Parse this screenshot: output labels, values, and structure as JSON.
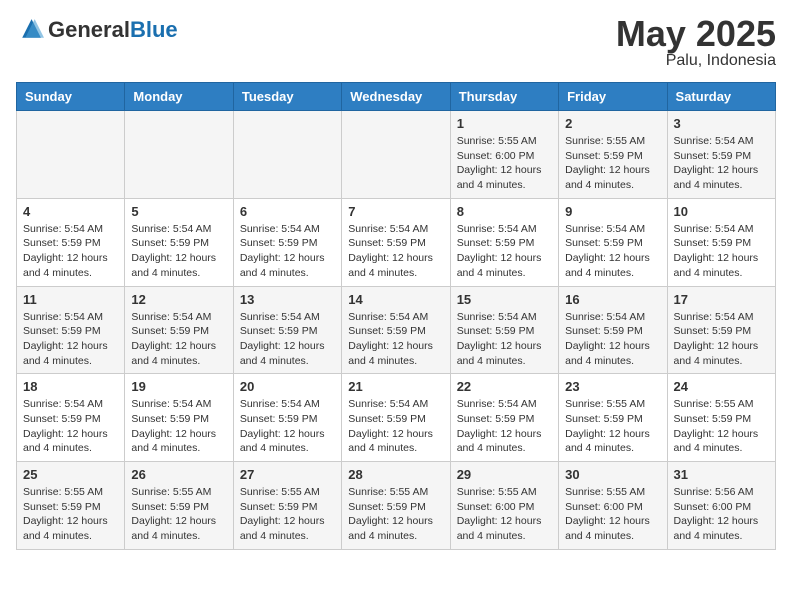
{
  "header": {
    "logo_general": "General",
    "logo_blue": "Blue",
    "month_title": "May 2025",
    "location": "Palu, Indonesia"
  },
  "days_of_week": [
    "Sunday",
    "Monday",
    "Tuesday",
    "Wednesday",
    "Thursday",
    "Friday",
    "Saturday"
  ],
  "weeks": [
    [
      {
        "day": "",
        "info": ""
      },
      {
        "day": "",
        "info": ""
      },
      {
        "day": "",
        "info": ""
      },
      {
        "day": "",
        "info": ""
      },
      {
        "day": "1",
        "sunrise": "5:55 AM",
        "sunset": "6:00 PM",
        "daylight": "12 hours and 4 minutes."
      },
      {
        "day": "2",
        "sunrise": "5:55 AM",
        "sunset": "5:59 PM",
        "daylight": "12 hours and 4 minutes."
      },
      {
        "day": "3",
        "sunrise": "5:54 AM",
        "sunset": "5:59 PM",
        "daylight": "12 hours and 4 minutes."
      }
    ],
    [
      {
        "day": "4",
        "sunrise": "5:54 AM",
        "sunset": "5:59 PM",
        "daylight": "12 hours and 4 minutes."
      },
      {
        "day": "5",
        "sunrise": "5:54 AM",
        "sunset": "5:59 PM",
        "daylight": "12 hours and 4 minutes."
      },
      {
        "day": "6",
        "sunrise": "5:54 AM",
        "sunset": "5:59 PM",
        "daylight": "12 hours and 4 minutes."
      },
      {
        "day": "7",
        "sunrise": "5:54 AM",
        "sunset": "5:59 PM",
        "daylight": "12 hours and 4 minutes."
      },
      {
        "day": "8",
        "sunrise": "5:54 AM",
        "sunset": "5:59 PM",
        "daylight": "12 hours and 4 minutes."
      },
      {
        "day": "9",
        "sunrise": "5:54 AM",
        "sunset": "5:59 PM",
        "daylight": "12 hours and 4 minutes."
      },
      {
        "day": "10",
        "sunrise": "5:54 AM",
        "sunset": "5:59 PM",
        "daylight": "12 hours and 4 minutes."
      }
    ],
    [
      {
        "day": "11",
        "sunrise": "5:54 AM",
        "sunset": "5:59 PM",
        "daylight": "12 hours and 4 minutes."
      },
      {
        "day": "12",
        "sunrise": "5:54 AM",
        "sunset": "5:59 PM",
        "daylight": "12 hours and 4 minutes."
      },
      {
        "day": "13",
        "sunrise": "5:54 AM",
        "sunset": "5:59 PM",
        "daylight": "12 hours and 4 minutes."
      },
      {
        "day": "14",
        "sunrise": "5:54 AM",
        "sunset": "5:59 PM",
        "daylight": "12 hours and 4 minutes."
      },
      {
        "day": "15",
        "sunrise": "5:54 AM",
        "sunset": "5:59 PM",
        "daylight": "12 hours and 4 minutes."
      },
      {
        "day": "16",
        "sunrise": "5:54 AM",
        "sunset": "5:59 PM",
        "daylight": "12 hours and 4 minutes."
      },
      {
        "day": "17",
        "sunrise": "5:54 AM",
        "sunset": "5:59 PM",
        "daylight": "12 hours and 4 minutes."
      }
    ],
    [
      {
        "day": "18",
        "sunrise": "5:54 AM",
        "sunset": "5:59 PM",
        "daylight": "12 hours and 4 minutes."
      },
      {
        "day": "19",
        "sunrise": "5:54 AM",
        "sunset": "5:59 PM",
        "daylight": "12 hours and 4 minutes."
      },
      {
        "day": "20",
        "sunrise": "5:54 AM",
        "sunset": "5:59 PM",
        "daylight": "12 hours and 4 minutes."
      },
      {
        "day": "21",
        "sunrise": "5:54 AM",
        "sunset": "5:59 PM",
        "daylight": "12 hours and 4 minutes."
      },
      {
        "day": "22",
        "sunrise": "5:54 AM",
        "sunset": "5:59 PM",
        "daylight": "12 hours and 4 minutes."
      },
      {
        "day": "23",
        "sunrise": "5:55 AM",
        "sunset": "5:59 PM",
        "daylight": "12 hours and 4 minutes."
      },
      {
        "day": "24",
        "sunrise": "5:55 AM",
        "sunset": "5:59 PM",
        "daylight": "12 hours and 4 minutes."
      }
    ],
    [
      {
        "day": "25",
        "sunrise": "5:55 AM",
        "sunset": "5:59 PM",
        "daylight": "12 hours and 4 minutes."
      },
      {
        "day": "26",
        "sunrise": "5:55 AM",
        "sunset": "5:59 PM",
        "daylight": "12 hours and 4 minutes."
      },
      {
        "day": "27",
        "sunrise": "5:55 AM",
        "sunset": "5:59 PM",
        "daylight": "12 hours and 4 minutes."
      },
      {
        "day": "28",
        "sunrise": "5:55 AM",
        "sunset": "5:59 PM",
        "daylight": "12 hours and 4 minutes."
      },
      {
        "day": "29",
        "sunrise": "5:55 AM",
        "sunset": "6:00 PM",
        "daylight": "12 hours and 4 minutes."
      },
      {
        "day": "30",
        "sunrise": "5:55 AM",
        "sunset": "6:00 PM",
        "daylight": "12 hours and 4 minutes."
      },
      {
        "day": "31",
        "sunrise": "5:56 AM",
        "sunset": "6:00 PM",
        "daylight": "12 hours and 4 minutes."
      }
    ]
  ],
  "labels": {
    "sunrise_prefix": "Sunrise: ",
    "sunset_prefix": "Sunset: ",
    "daylight_prefix": "Daylight: "
  }
}
